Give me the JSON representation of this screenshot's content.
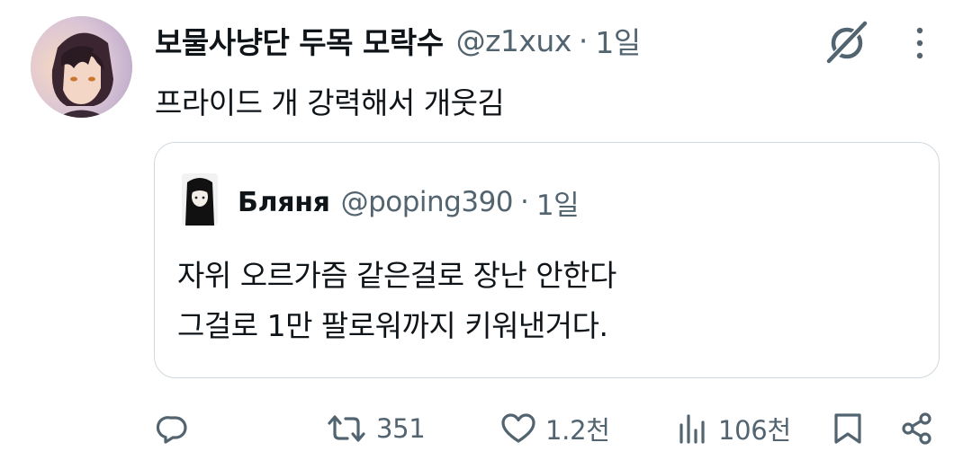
{
  "tweet": {
    "display_name": "보물사냥단 두목 모락수",
    "handle": "@z1xux",
    "separator": "·",
    "time": "1일",
    "text": "프라이드 개 강력해서 개웃김"
  },
  "quote": {
    "display_name": "Бляня",
    "handle": "@poping390",
    "separator": "·",
    "time": "1일",
    "lines": [
      "자위 오르가즘 같은걸로 장난 안한다",
      "그걸로 1만 팔로워까지 키워낸거다."
    ]
  },
  "actions": {
    "retweets": "351",
    "likes": "1.2천",
    "views": "106천"
  },
  "icons": {
    "grok": "grok-icon",
    "more": "more-icon",
    "reply": "reply-icon",
    "retweet": "retweet-icon",
    "like": "heart-icon",
    "views": "views-icon",
    "bookmark": "bookmark-icon",
    "share": "share-icon"
  },
  "colors": {
    "text": "#0f1419",
    "secondary": "#536471",
    "border": "#cfd9de"
  }
}
